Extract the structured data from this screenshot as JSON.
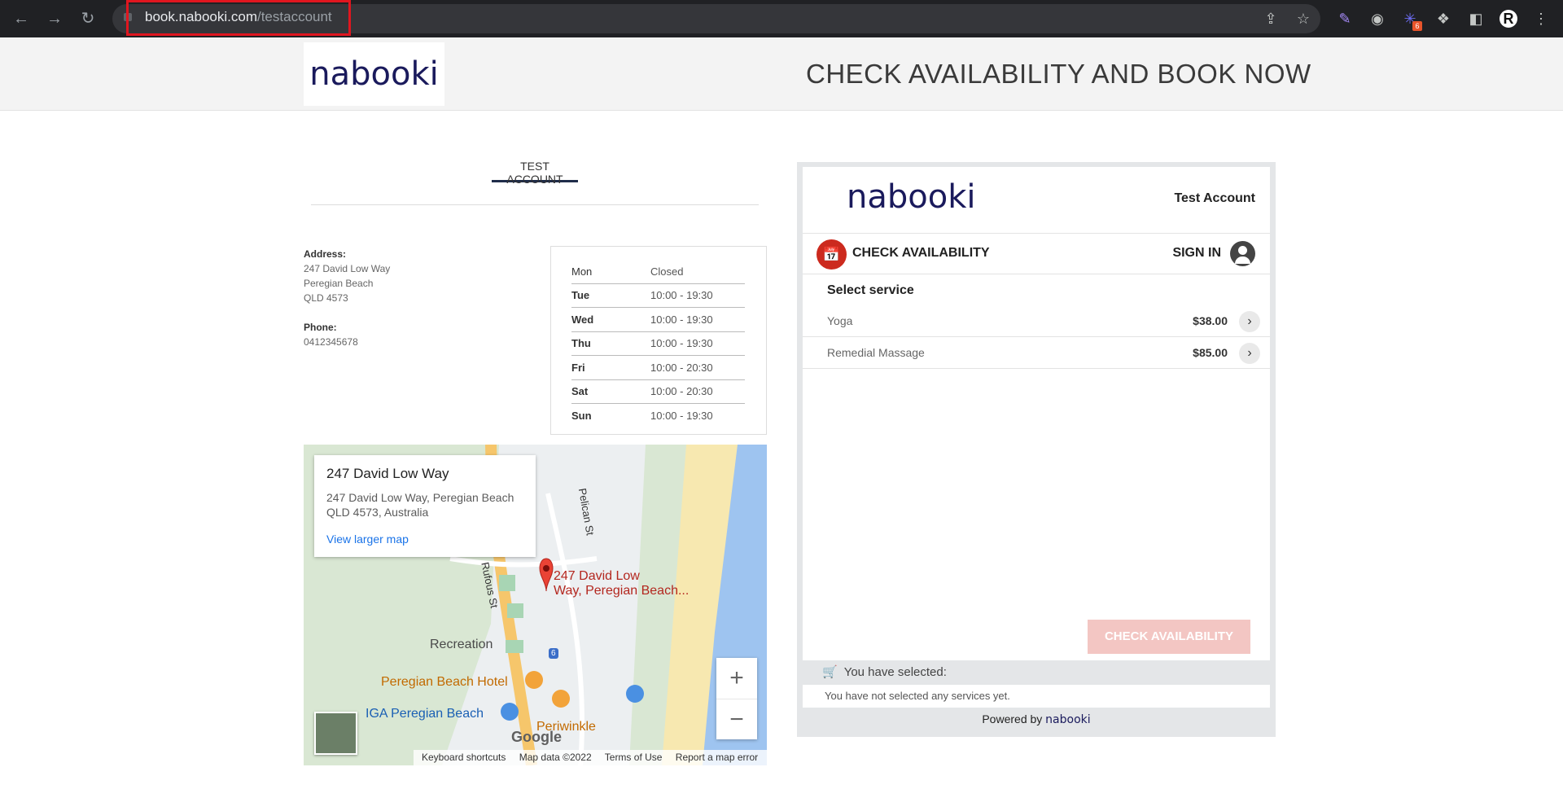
{
  "browser": {
    "url_host": "book.nabooki.com",
    "url_path": "/testaccount",
    "extension_badge": "6",
    "profile_initial": "R"
  },
  "header": {
    "logo": "nabooki",
    "headline": "CHECK AVAILABILITY AND BOOK NOW"
  },
  "account_tab": "TEST ACCOUNT",
  "info": {
    "address_label": "Address:",
    "address_lines": [
      "247 David Low Way",
      "Peregian Beach",
      "QLD 4573"
    ],
    "phone_label": "Phone:",
    "phone": "0412345678"
  },
  "hours": [
    {
      "day": "Mon",
      "time": "Closed"
    },
    {
      "day": "Tue",
      "time": "10:00 - 19:30"
    },
    {
      "day": "Wed",
      "time": "10:00 - 19:30"
    },
    {
      "day": "Thu",
      "time": "10:00 - 19:30"
    },
    {
      "day": "Fri",
      "time": "10:00 - 20:30"
    },
    {
      "day": "Sat",
      "time": "10:00 - 20:30"
    },
    {
      "day": "Sun",
      "time": "10:00 - 19:30"
    }
  ],
  "map": {
    "card_title": "247 David Low Way",
    "card_address_1": "247 David Low Way, Peregian Beach",
    "card_address_2": "QLD 4573, Australia",
    "card_link": "View larger map",
    "pin_label_1": "247 David Low",
    "pin_label_2": "Way, Peregian Beach...",
    "labels": {
      "pelican": "Pelican St",
      "rufous": "Rufous St",
      "recreation": "Recreation",
      "hotel": "Peregian Beach Hotel",
      "iga": "IGA Peregian Beach",
      "periwinkle": "Periwinkle",
      "route": "6"
    },
    "zoom_in": "+",
    "zoom_out": "−",
    "google": "Google",
    "footer": {
      "shortcuts": "Keyboard shortcuts",
      "data": "Map data ©2022",
      "terms": "Terms of Use",
      "report": "Report a map error"
    }
  },
  "widget": {
    "logo": "nabooki",
    "account": "Test Account",
    "check_label": "CHECK AVAILABILITY",
    "sign_in": "SIGN IN",
    "select_service": "Select service",
    "services": [
      {
        "name": "Yoga",
        "price": "$38.00"
      },
      {
        "name": "Remedial Massage",
        "price": "$85.00"
      }
    ],
    "button": "CHECK AVAILABILITY",
    "selected_label": "You have selected:",
    "none_selected": "You have not selected any services yet.",
    "powered_by": "Powered by",
    "powered_brand": "nabooki"
  }
}
